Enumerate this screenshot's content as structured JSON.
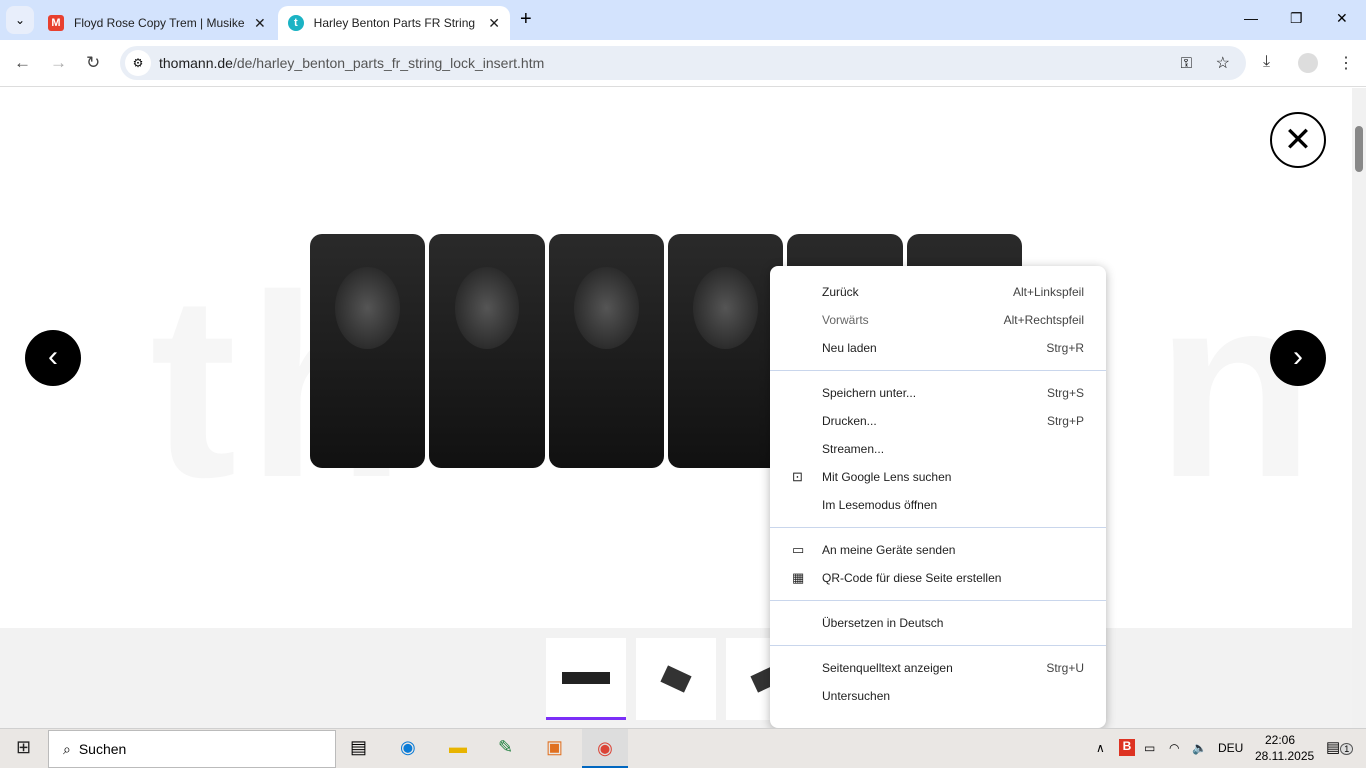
{
  "tabs": [
    {
      "title": "Floyd Rose Copy Trem | Musiker",
      "favicon": "M",
      "color": "#e8402f"
    },
    {
      "title": "Harley Benton Parts FR String Lock Insert",
      "favicon": "t",
      "color": "#1bb3c4"
    }
  ],
  "url": {
    "domain": "thomann.de",
    "path": "/de/harley_benton_parts_fr_string_lock_insert.htm"
  },
  "watermark": "thomann",
  "menu": [
    [
      {
        "label": "Zurück",
        "shortcut": "Alt+Linkspfeil"
      },
      {
        "label": "Vorwärts",
        "shortcut": "Alt+Rechtspfeil",
        "disabled": true
      },
      {
        "label": "Neu laden",
        "shortcut": "Strg+R"
      }
    ],
    [
      {
        "label": "Speichern unter...",
        "shortcut": "Strg+S"
      },
      {
        "label": "Drucken...",
        "shortcut": "Strg+P"
      },
      {
        "label": "Streamen...",
        "shortcut": ""
      },
      {
        "label": "Mit Google Lens suchen",
        "shortcut": "",
        "icon": "⊡"
      },
      {
        "label": "Im Lesemodus öffnen",
        "shortcut": ""
      }
    ],
    [
      {
        "label": "An meine Geräte senden",
        "shortcut": "",
        "icon": "▭"
      },
      {
        "label": "QR-Code für diese Seite erstellen",
        "shortcut": "",
        "icon": "▦"
      }
    ],
    [
      {
        "label": "Übersetzen in Deutsch",
        "shortcut": ""
      }
    ],
    [
      {
        "label": "Seitenquelltext anzeigen",
        "shortcut": "Strg+U"
      },
      {
        "label": "Untersuchen",
        "shortcut": ""
      }
    ]
  ],
  "taskbar": {
    "search": "Suchen",
    "lang": "DEU",
    "time": "22:06",
    "date": "28.11.2025",
    "notifications": "1"
  }
}
